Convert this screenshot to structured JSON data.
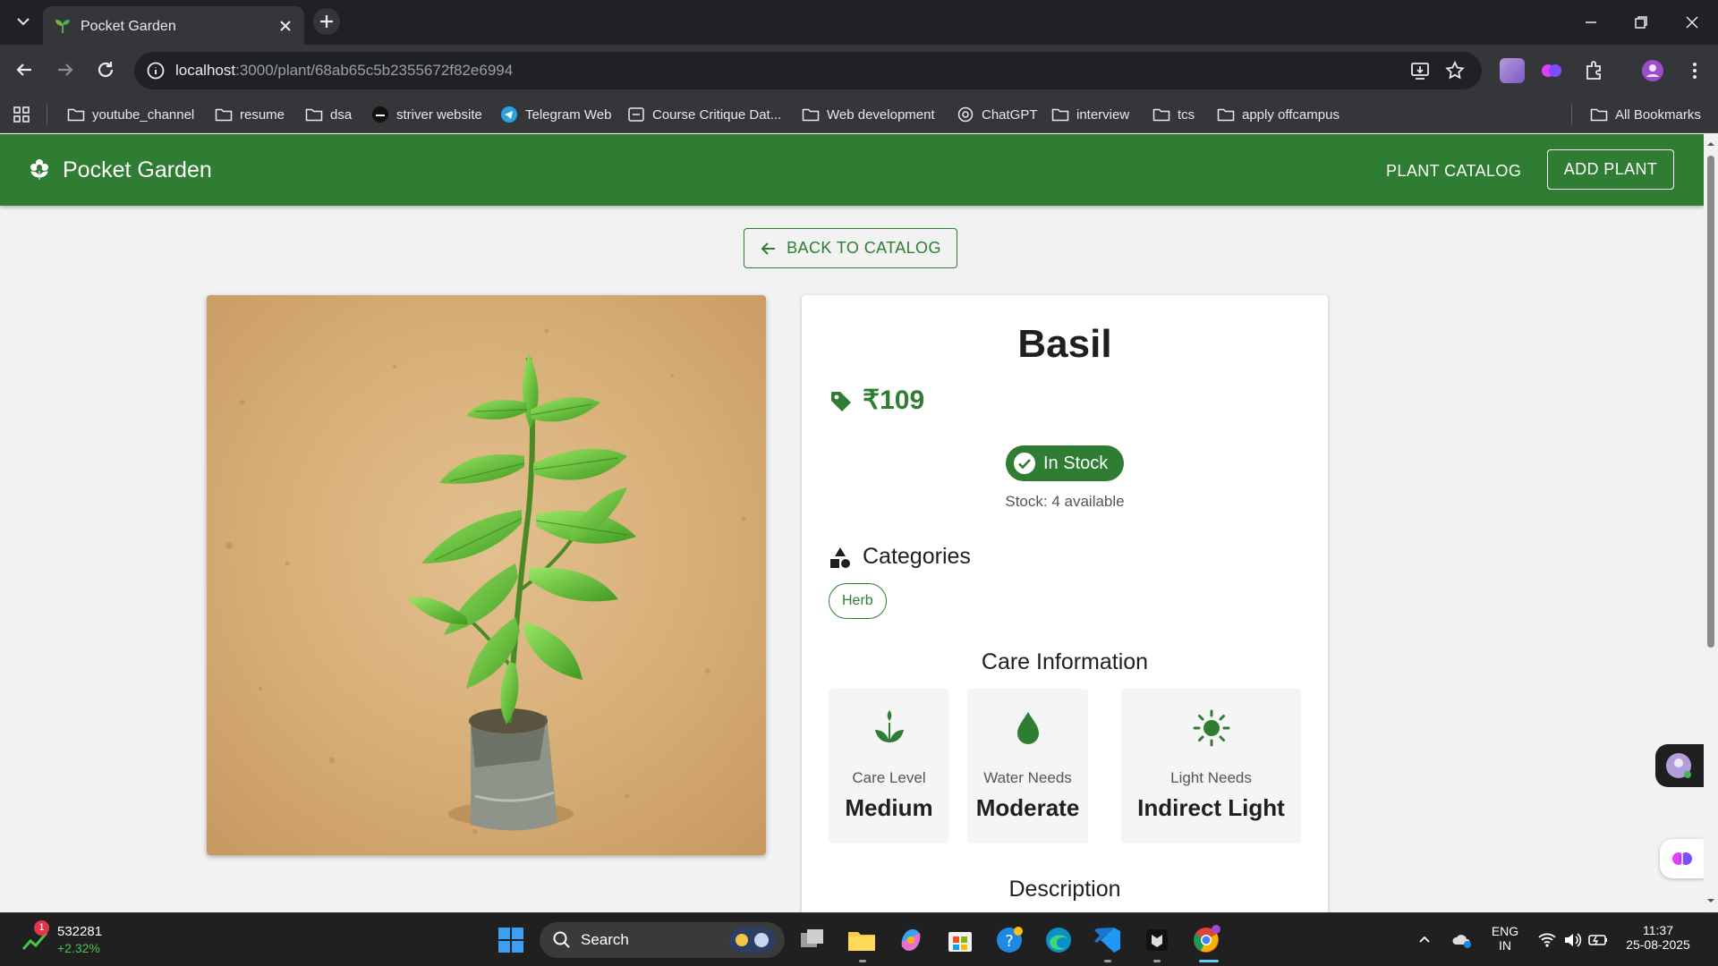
{
  "browser": {
    "tab_title": "Pocket Garden",
    "url_host": "localhost",
    "url_path": ":3000/plant/68ab65c5b2355672f82e6994",
    "bookmarks": [
      "youtube_channel",
      "resume",
      "dsa",
      "striver website",
      "Telegram Web",
      "Course Critique Dat...",
      "Web development",
      "ChatGPT",
      "interview",
      "tcs",
      "apply offcampus"
    ],
    "all_bookmarks": "All Bookmarks"
  },
  "app": {
    "brand": "Pocket Garden",
    "nav_catalog": "PLANT CATALOG",
    "nav_add": "ADD PLANT",
    "back_label": "BACK TO CATALOG"
  },
  "plant": {
    "name": "Basil",
    "price": "₹109",
    "stock_status": "In Stock",
    "stock_text": "Stock: 4 available",
    "categories_title": "Categories",
    "categories": [
      "Herb"
    ],
    "care_title": "Care Information",
    "care": [
      {
        "label": "Care Level",
        "value": "Medium",
        "icon": "seedling-icon"
      },
      {
        "label": "Water Needs",
        "value": "Moderate",
        "icon": "water-drop-icon"
      },
      {
        "label": "Light Needs",
        "value": "Indirect Light",
        "icon": "sun-icon"
      }
    ],
    "description_title": "Description"
  },
  "taskbar": {
    "stock_badge": "1",
    "stock_value": "532281",
    "stock_change": "+2.32%",
    "search": "Search",
    "lang_top": "ENG",
    "lang_bottom": "IN",
    "time": "11:37",
    "date": "25-08-2025"
  },
  "colors": {
    "brand_green": "#2e7d32",
    "chrome_dark": "#202124",
    "chrome_mid": "#35363a"
  }
}
